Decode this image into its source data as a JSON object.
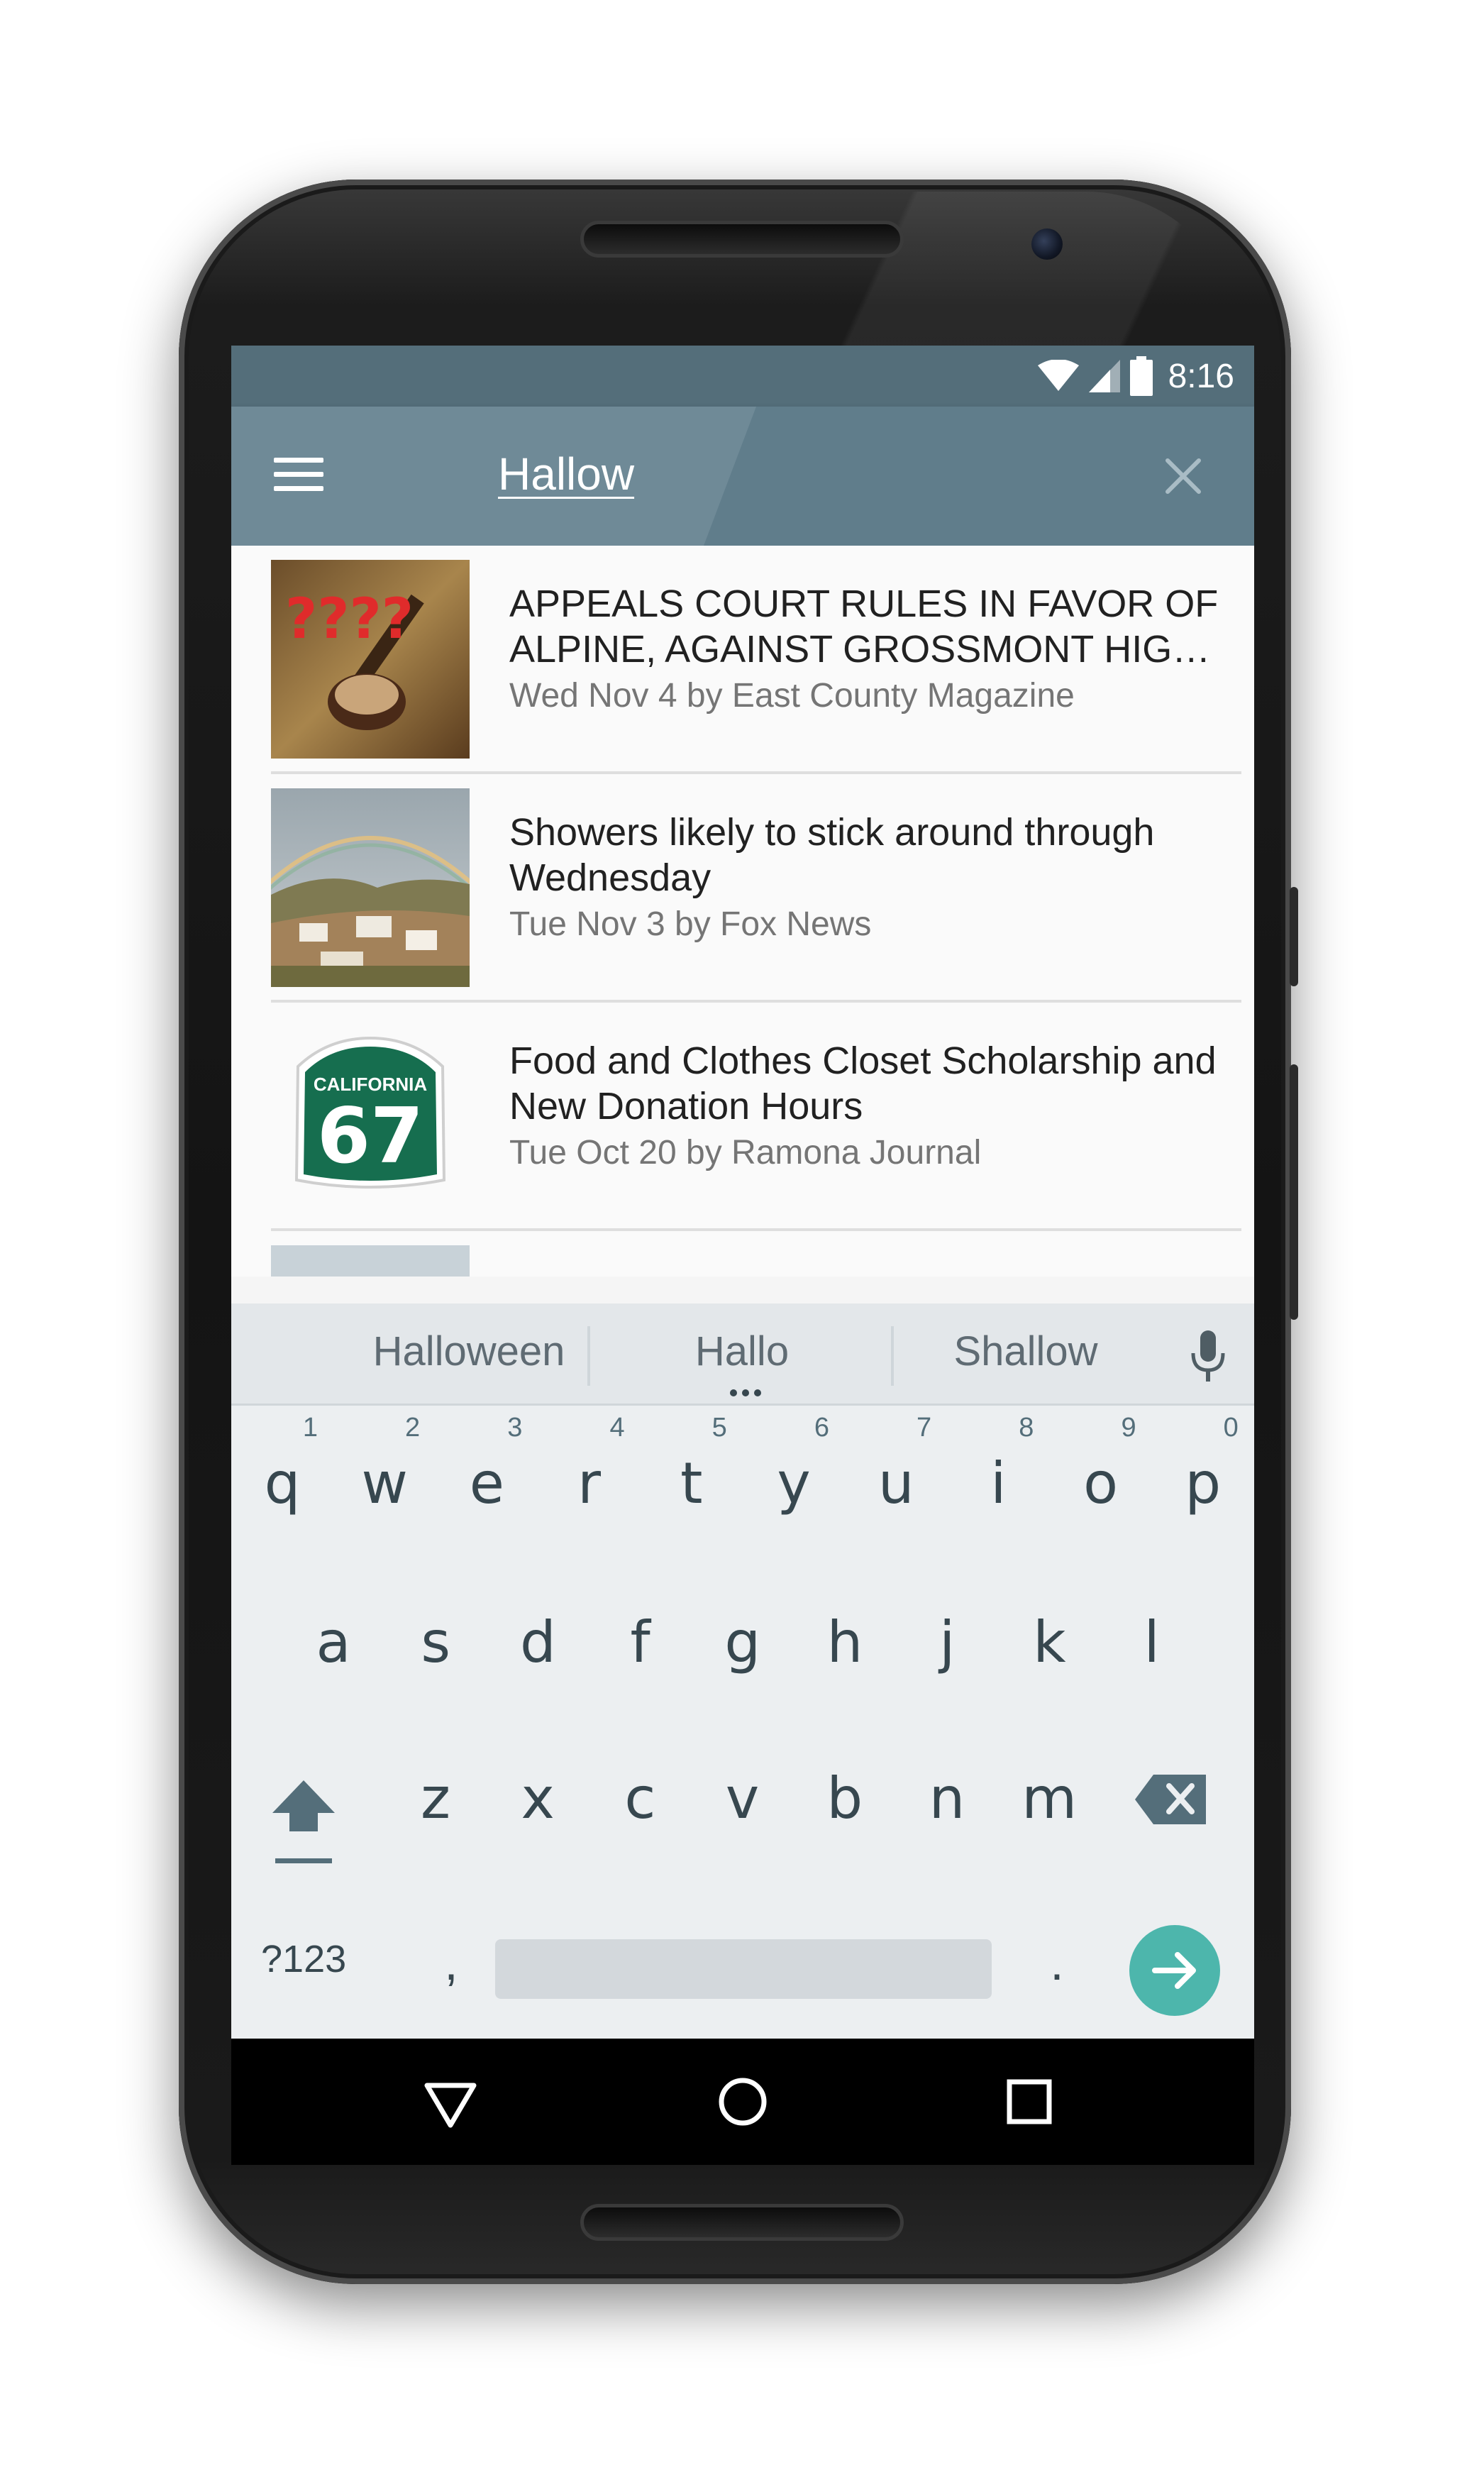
{
  "status_bar": {
    "time": "8:16",
    "icons": [
      "wifi-icon",
      "cell-signal-icon",
      "battery-icon"
    ]
  },
  "toolbar": {
    "search_query": "Hallow",
    "menu_icon": "menu-icon",
    "close_icon": "close-icon",
    "colors": {
      "status_bar": "#546e7a",
      "toolbar": "#607d8b"
    }
  },
  "articles": [
    {
      "title": "APPEALS COURT RULES IN FAVOR OF ALPINE, AGAINST GROSSMONT HIG…",
      "meta": "Wed Nov 4 by East County Magazine",
      "thumb_text": "????"
    },
    {
      "title": "Showers likely to stick around through Wednesday",
      "meta": "Tue Nov 3 by Fox News"
    },
    {
      "title": "Food and Clothes Closet Scholarship and New Donation Hours",
      "meta": "Tue Oct 20 by Ramona Journal",
      "thumb_sign_top": "CALIFORNIA",
      "thumb_sign_number": "67"
    }
  ],
  "keyboard": {
    "suggestions": [
      "Halloween",
      "Hallo",
      "Shallow"
    ],
    "row1": [
      {
        "k": "q",
        "h": "1"
      },
      {
        "k": "w",
        "h": "2"
      },
      {
        "k": "e",
        "h": "3"
      },
      {
        "k": "r",
        "h": "4"
      },
      {
        "k": "t",
        "h": "5"
      },
      {
        "k": "y",
        "h": "6"
      },
      {
        "k": "u",
        "h": "7"
      },
      {
        "k": "i",
        "h": "8"
      },
      {
        "k": "o",
        "h": "9"
      },
      {
        "k": "p",
        "h": "0"
      }
    ],
    "row2": [
      "a",
      "s",
      "d",
      "f",
      "g",
      "h",
      "j",
      "k",
      "l"
    ],
    "row3": [
      "z",
      "x",
      "c",
      "v",
      "b",
      "n",
      "m"
    ],
    "symbols_label": "?123",
    "comma_label": ",",
    "period_label": ".",
    "accent_color": "#4db6ac"
  },
  "nav_bar": {
    "buttons": [
      "back-icon",
      "home-icon",
      "recents-icon"
    ]
  }
}
